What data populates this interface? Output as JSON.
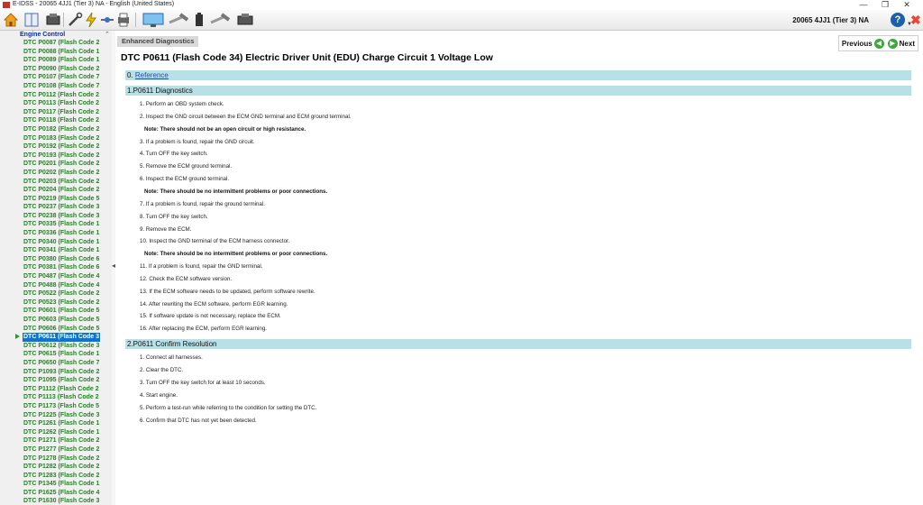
{
  "window": {
    "title": "E-IDSS - 20065 4JJ1 (Tier 3)  NA - English (United States)",
    "minimize": "—",
    "maximize": "❐",
    "close": "✕"
  },
  "toolbar": {
    "icons": [
      "home-icon",
      "book-icon",
      "engine-icon",
      "tools-icon",
      "flash-icon",
      "probe-icon",
      "printer-icon",
      "monitor-icon",
      "hammer-icon",
      "battery-icon",
      "wrench-icon",
      "hammer2-icon",
      "engine2-icon"
    ],
    "vehicle": "20065 4JJ1 (Tier 3)  NA",
    "help": "?",
    "dropdown": "▼",
    "exit": "✖"
  },
  "sidebar": {
    "header": "Engine Control",
    "items": [
      "DTC P0087 (Flash Code 2",
      "DTC P0088 (Flash Code 1",
      "DTC P0089 (Flash Code 1",
      "DTC P0090 (Flash Code 2",
      "DTC P0107 (Flash Code 7",
      "DTC P0108 (Flash Code 7",
      "DTC P0112 (Flash Code 2",
      "DTC P0113 (Flash Code 2",
      "DTC P0117 (Flash Code 2",
      "DTC P0118 (Flash Code 2",
      "DTC P0182 (Flash Code 2",
      "DTC P0183 (Flash Code 2",
      "DTC P0192 (Flash Code 2",
      "DTC P0193 (Flash Code 2",
      "DTC P0201 (Flash Code 2",
      "DTC P0202 (Flash Code 2",
      "DTC P0203 (Flash Code 2",
      "DTC P0204 (Flash Code 2",
      "DTC P0219 (Flash Code 5",
      "DTC P0237 (Flash Code 3",
      "DTC P0238 (Flash Code 3",
      "DTC P0335 (Flash Code 1",
      "DTC P0336 (Flash Code 1",
      "DTC P0340 (Flash Code 1",
      "DTC P0341 (Flash Code 1",
      "DTC P0380 (Flash Code 6",
      "DTC P0381 (Flash Code 6",
      "DTC P0487 (Flash Code 4",
      "DTC P0488 (Flash Code 4",
      "DTC P0522 (Flash Code 2",
      "DTC P0523 (Flash Code 2",
      "DTC P0601 (Flash Code 5",
      "DTC P0603 (Flash Code 5",
      "DTC P0606 (Flash Code 5",
      "DTC P0611 (Flash Code 3",
      "DTC P0612 (Flash Code 3",
      "DTC P0615 (Flash Code 1",
      "DTC P0650 (Flash Code 7",
      "DTC P1093 (Flash Code 2",
      "DTC P1095 (Flash Code 2",
      "DTC P1112 (Flash Code 2",
      "DTC P1113 (Flash Code 2",
      "DTC P1173 (Flash Code 5",
      "DTC P1225 (Flash Code 3",
      "DTC P1261 (Flash Code 1",
      "DTC P1262 (Flash Code 1",
      "DTC P1271 (Flash Code 2",
      "DTC P1277 (Flash Code 2",
      "DTC P1278 (Flash Code 2",
      "DTC P1282 (Flash Code 2",
      "DTC P1283 (Flash Code 2",
      "DTC P1345 (Flash Code 1",
      "DTC P1625 (Flash Code 4",
      "DTC P1630 (Flash Code 3"
    ],
    "selected_index": 34
  },
  "content": {
    "breadcrumb": "Enhanced Diagnostics",
    "previous": "Previous",
    "next": "Next",
    "title": "DTC P0611 (Flash Code 34) Electric Driver Unit (EDU) Charge Circuit 1 Voltage Low",
    "ref_prefix": "0.",
    "ref_link": "Reference",
    "section1": "1.P0611 Diagnostics",
    "diag_steps": [
      {
        "text": "1. Perform an OBD system check."
      },
      {
        "text": "2. Inspect the GND circuit between the ECM GND terminal and ECM ground terminal."
      },
      {
        "note": "Note: There should not be an open circuit or high resistance."
      },
      {
        "text": "3. If a problem is found, repair the GND circuit."
      },
      {
        "text": "4. Turn OFF the key switch."
      },
      {
        "text": "5. Remove the ECM ground terminal."
      },
      {
        "text": "6. Inspect the ECM ground terminal."
      },
      {
        "note": "Note: There should be no intermittent problems or poor connections."
      },
      {
        "text": "7. If a problem is found, repair the ground terminal."
      },
      {
        "text": "8. Turn OFF the key switch."
      },
      {
        "text": "9. Remove the ECM."
      },
      {
        "text": "10. Inspect the GND terminal of the ECM harness connector."
      },
      {
        "note": "Note: There should be no intermittent problems or poor connections."
      },
      {
        "text": "11. If a problem is found, repair the GND terminal."
      },
      {
        "text": "12. Check the ECM software version."
      },
      {
        "text": "13. If the ECM software needs to be updated, perform software rewrite."
      },
      {
        "text": "14. After rewriting the ECM software, perform EGR learning."
      },
      {
        "text": "15. If software update is not necessary, replace the ECM."
      },
      {
        "text": "16. After replacing the ECM, perform EGR learning."
      }
    ],
    "section2": "2.P0611 Confirm Resolution",
    "confirm_steps": [
      "1. Connect all harnesses.",
      "2. Clear the DTC.",
      "3. Turn OFF the key switch for at least 10 seconds.",
      "4. Start engine.",
      "5. Perform a test-run while referring to the condition for setting the DTC.",
      "6. Confirm that DTC has not yet been detected."
    ]
  },
  "colors": {
    "accent": "#0a74d6",
    "dtc_green": "#1c8a1c",
    "section_bg": "#b7e1e7",
    "header_blue": "#0b2ea6"
  }
}
